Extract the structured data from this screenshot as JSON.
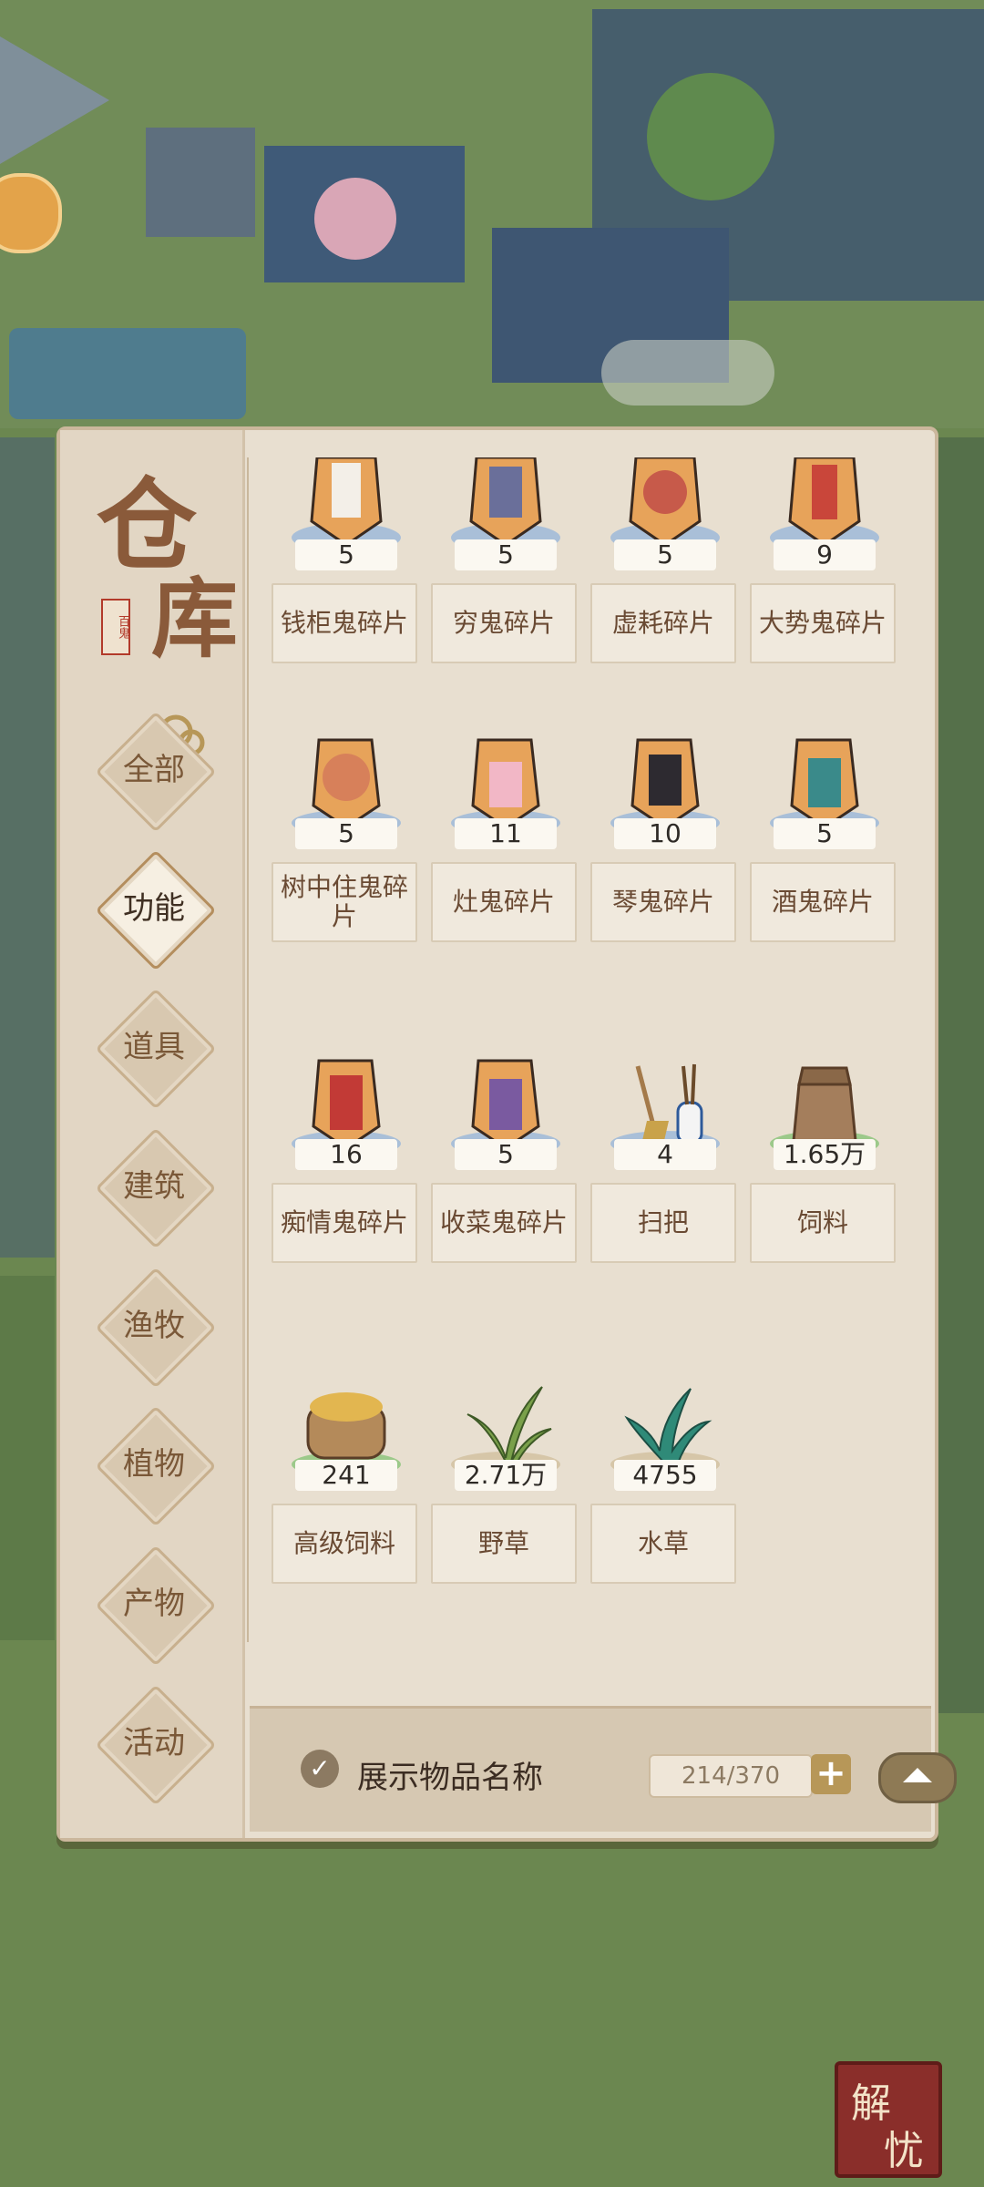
{
  "panel": {
    "title_char1": "仓",
    "title_char2": "库",
    "seal_text": "百鬼"
  },
  "categories": [
    {
      "label": "全部",
      "active": false
    },
    {
      "label": "功能",
      "active": true
    },
    {
      "label": "道具",
      "active": false
    },
    {
      "label": "建筑",
      "active": false
    },
    {
      "label": "渔牧",
      "active": false
    },
    {
      "label": "植物",
      "active": false
    },
    {
      "label": "产物",
      "active": false
    },
    {
      "label": "活动",
      "active": false
    }
  ],
  "items": [
    {
      "name": "钱柜鬼碎片",
      "count": "5",
      "icon": "ghost-fragment-icon"
    },
    {
      "name": "穷鬼碎片",
      "count": "5",
      "icon": "ghost-fragment-icon"
    },
    {
      "name": "虚耗碎片",
      "count": "5",
      "icon": "ghost-fragment-icon"
    },
    {
      "name": "大势鬼碎片",
      "count": "9",
      "icon": "ghost-fragment-icon"
    },
    {
      "name": "树中住鬼碎片",
      "count": "5",
      "icon": "ghost-fragment-icon"
    },
    {
      "name": "灶鬼碎片",
      "count": "11",
      "icon": "ghost-fragment-icon"
    },
    {
      "name": "琴鬼碎片",
      "count": "10",
      "icon": "ghost-fragment-icon"
    },
    {
      "name": "酒鬼碎片",
      "count": "5",
      "icon": "ghost-fragment-icon"
    },
    {
      "name": "痴情鬼碎片",
      "count": "16",
      "icon": "ghost-fragment-icon"
    },
    {
      "name": "收菜鬼碎片",
      "count": "5",
      "icon": "ghost-fragment-icon"
    },
    {
      "name": "扫把",
      "count": "4",
      "icon": "broom-icon"
    },
    {
      "name": "饲料",
      "count": "1.65万",
      "icon": "feed-sack-icon"
    },
    {
      "name": "高级饲料",
      "count": "241",
      "icon": "premium-feed-icon"
    },
    {
      "name": "野草",
      "count": "2.71万",
      "icon": "grass-icon"
    },
    {
      "name": "水草",
      "count": "4755",
      "icon": "waterweed-icon"
    }
  ],
  "footer": {
    "show_names_label": "展示物品名称",
    "show_names_checked": true,
    "capacity": "214/370",
    "plus": "+"
  },
  "corner_badge": {
    "c1": "解",
    "c2": "忧"
  },
  "colors": {
    "panel_bg": "#e8dfd0",
    "text_brown": "#6a4a33",
    "accent_gold": "#b79758"
  }
}
